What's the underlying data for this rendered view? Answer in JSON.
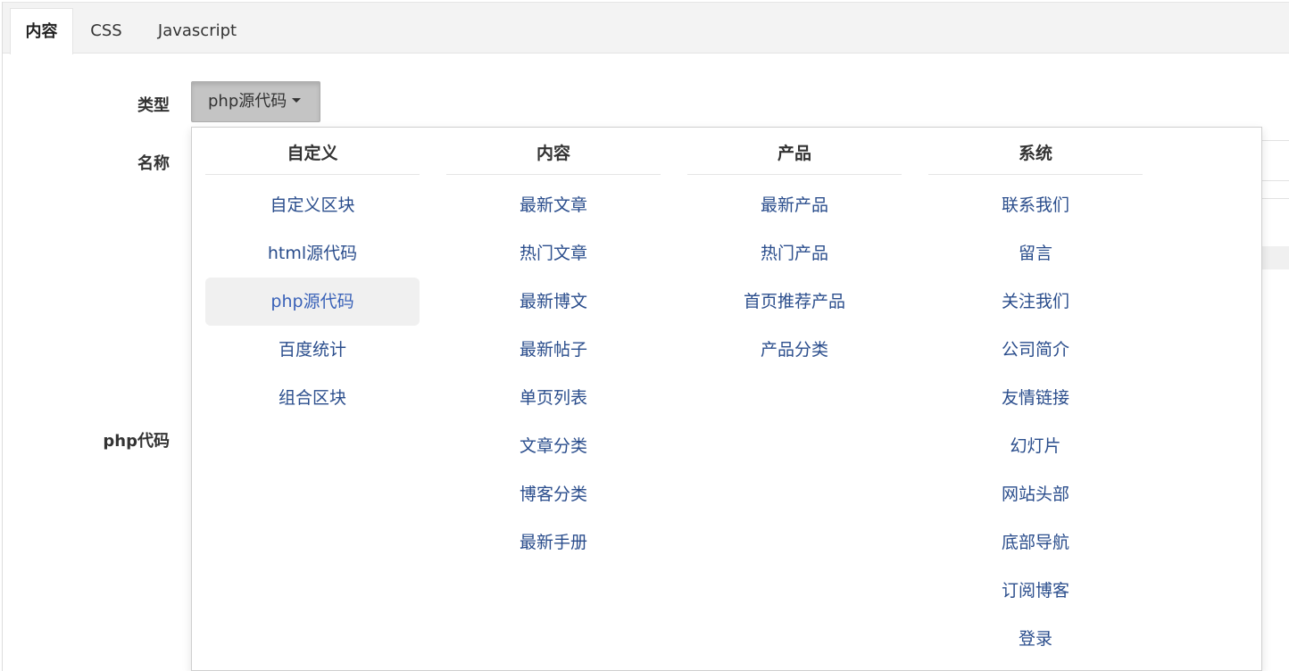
{
  "tabs": [
    {
      "label": "内容",
      "active": true
    },
    {
      "label": "CSS",
      "active": false
    },
    {
      "label": "Javascript",
      "active": false
    }
  ],
  "form": {
    "type_label": "类型",
    "name_label": "名称",
    "php_label": "php代码",
    "type_value": "php源代码"
  },
  "dropdown": {
    "columns": [
      {
        "header": "自定义",
        "items": [
          "自定义区块",
          "html源代码",
          "php源代码",
          "百度统计",
          "组合区块"
        ],
        "selected_index": 2
      },
      {
        "header": "内容",
        "items": [
          "最新文章",
          "热门文章",
          "最新博文",
          "最新帖子",
          "单页列表",
          "文章分类",
          "博客分类",
          "最新手册"
        ]
      },
      {
        "header": "产品",
        "items": [
          "最新产品",
          "热门产品",
          "首页推荐产品",
          "产品分类"
        ]
      },
      {
        "header": "系统",
        "items": [
          "联系我们",
          "留言",
          "关注我们",
          "公司简介",
          "友情链接",
          "幻灯片",
          "网站头部",
          "底部导航",
          "订阅博客",
          "登录"
        ]
      }
    ]
  },
  "colors": {
    "link": "#2a4d8c",
    "selected_link": "#3a62b8",
    "selected_bg": "#f0f0f0",
    "button_bg": "#c4c4c4"
  }
}
